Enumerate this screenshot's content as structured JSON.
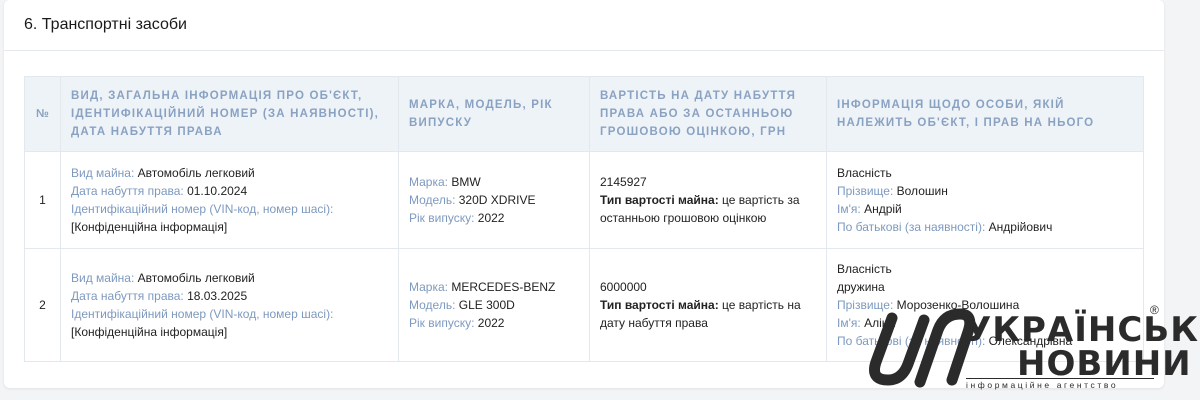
{
  "section": {
    "title": "6. Транспортні засоби"
  },
  "table": {
    "headers": {
      "num": "№",
      "object": "Вид, загальна інформація про об'єкт, ідентифікаційний номер (за наявності), дата набуття права",
      "brand": "Марка, модель, рік випуску",
      "value": "Вартість на дату набуття права або за останньою грошовою оцінкою, грн",
      "owner": "Інформація щодо особи, якій належить об'єкт, і прав на нього"
    },
    "rows": [
      {
        "num": "1",
        "type_label": "Вид майна:",
        "type_value": "Автомобіль легковий",
        "date_label": "Дата набуття права:",
        "date_value": "01.10.2024",
        "vin_label": "Ідентифікаційний номер (VIN-код, номер шасі):",
        "vin_value": "[Конфіденційна інформація]",
        "brand_label": "Марка:",
        "brand_value": "BMW",
        "model_label": "Модель:",
        "model_value": "320D XDRIVE",
        "year_label": "Рік випуску:",
        "year_value": "2022",
        "price": "2145927",
        "price_type_label": "Тип вартості майна:",
        "price_type_value_1": "це вартість за",
        "price_type_value_2": "останньою грошовою оцінкою",
        "right": "Власність",
        "relation": "",
        "surname_label": "Прізвище:",
        "surname_value": "Волошин",
        "name_label": "Ім'я:",
        "name_value": "Андрій",
        "patronymic_label": "По батькові (за наявності):",
        "patronymic_value": "Андрійович"
      },
      {
        "num": "2",
        "type_label": "Вид майна:",
        "type_value": "Автомобіль легковий",
        "date_label": "Дата набуття права:",
        "date_value": "18.03.2025",
        "vin_label": "Ідентифікаційний номер (VIN-код, номер шасі):",
        "vin_value": "[Конфіденційна інформація]",
        "brand_label": "Марка:",
        "brand_value": "MERCEDES-BENZ",
        "model_label": "Модель:",
        "model_value": "GLE 300D",
        "year_label": "Рік випуску:",
        "year_value": "2022",
        "price": "6000000",
        "price_type_label": "Тип вартості майна:",
        "price_type_value_1": "це вартість на",
        "price_type_value_2": "дату набуття права",
        "right": "Власність",
        "relation": "дружина",
        "surname_label": "Прізвище:",
        "surname_value": "Морозенко-Волошина",
        "name_label": "Ім'я:",
        "name_value": "Аліна",
        "patronymic_label": "По батькові (за наявності):",
        "patronymic_value": "Олександрівна"
      }
    ]
  },
  "watermark": {
    "line1": "УКРАЇНСЬКІ",
    "line2": "НОВИНИ",
    "subtitle": "інформаційне агентство",
    "registered": "®"
  }
}
